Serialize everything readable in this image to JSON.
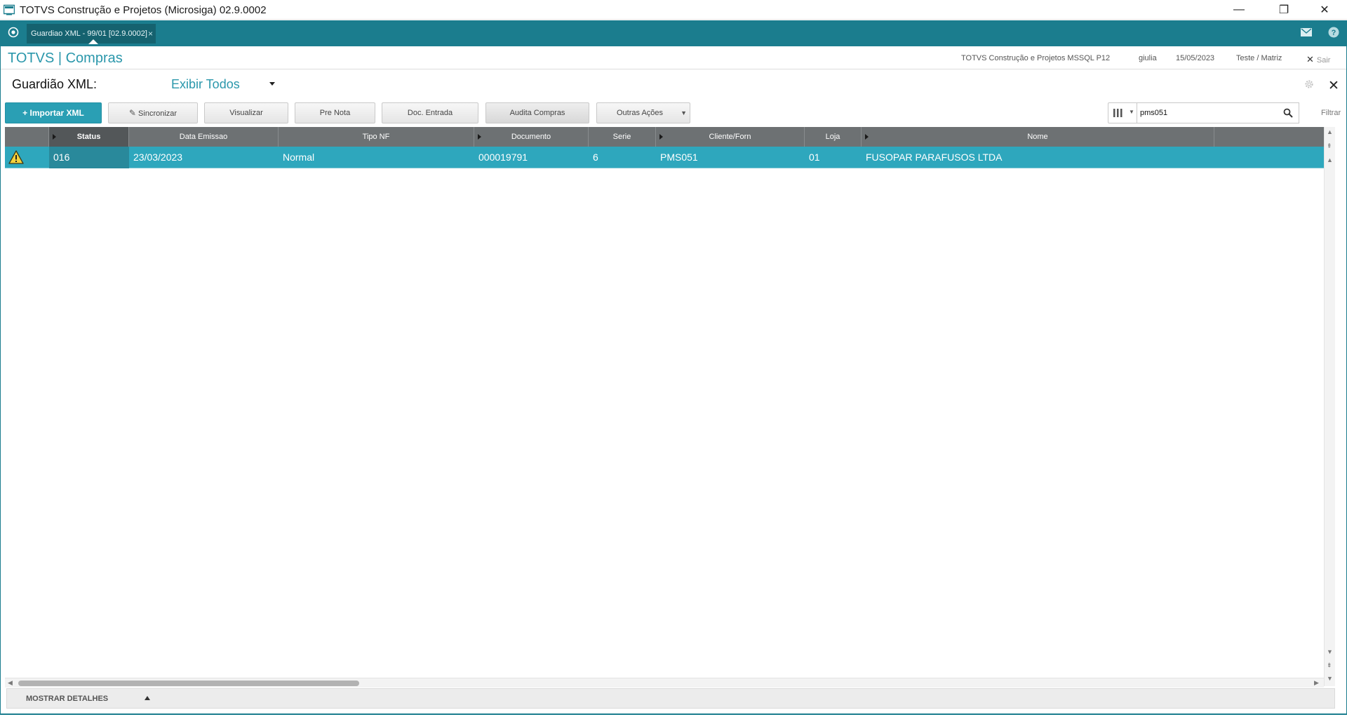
{
  "window": {
    "title": "TOTVS Construção e Projetos (Microsiga) 02.9.0002",
    "minimize": "—",
    "restore": "❐",
    "close": "✕"
  },
  "tabs": [
    {
      "label": "Guardiao XML - 99/01 [02.9.0002]",
      "close": "×"
    }
  ],
  "header": {
    "brand": "TOTVS | Compras",
    "environment": "TOTVS Construção e Projetos MSSQL P12",
    "user": "giulia",
    "date": "15/05/2023",
    "branch": "Teste / Matriz",
    "exit_label": "Sair"
  },
  "page": {
    "title": "Guardião XML:",
    "view_selector": "Exibir Todos"
  },
  "toolbar": {
    "import_label": "+ Importar XML",
    "sync_label": "Sincronizar",
    "view_label": "Visualizar",
    "prenota_label": "Pre Nota",
    "docentrada_label": "Doc. Entrada",
    "audita_label": "Audita Compras",
    "outras_label": "Outras Ações"
  },
  "search": {
    "value": "pms051",
    "filter_label": "Filtrar"
  },
  "grid": {
    "columns": [
      "",
      "Status",
      "Data Emissao",
      "Tipo NF",
      "Documento",
      "Serie",
      "Cliente/Forn",
      "Loja",
      "Nome",
      ""
    ],
    "rows": [
      {
        "status": "016",
        "data_emissao": "23/03/2023",
        "tipo_nf": "Normal",
        "documento": "000019791",
        "serie": "6",
        "cliente_forn": "PMS051",
        "loja": "01",
        "nome": "FUSOPAR PARAFUSOS LTDA"
      }
    ]
  },
  "footer": {
    "details_label": "MOSTRAR DETALHES"
  },
  "colors": {
    "accent": "#2a97ab",
    "tabbar": "#1b7d8e",
    "selected_row": "#2ea7bd",
    "grid_header": "#6d7173"
  }
}
